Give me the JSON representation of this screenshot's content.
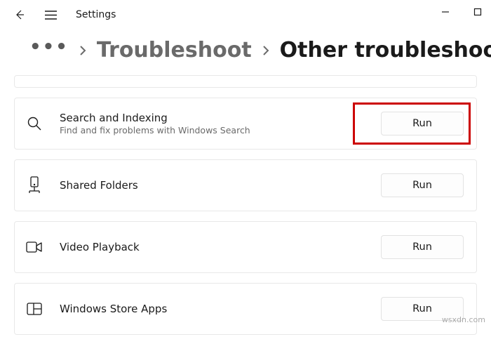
{
  "app": {
    "title": "Settings"
  },
  "breadcrumb": {
    "overflow": "•••",
    "parent": "Troubleshoot",
    "current": "Other troubleshooters"
  },
  "troubleshooters": [
    {
      "title": "Search and Indexing",
      "desc": "Find and fix problems with Windows Search",
      "button": "Run",
      "highlighted": true
    },
    {
      "title": "Shared Folders",
      "desc": "",
      "button": "Run",
      "highlighted": false
    },
    {
      "title": "Video Playback",
      "desc": "",
      "button": "Run",
      "highlighted": false
    },
    {
      "title": "Windows Store Apps",
      "desc": "",
      "button": "Run",
      "highlighted": false
    }
  ],
  "watermark": "wsxdn.com"
}
